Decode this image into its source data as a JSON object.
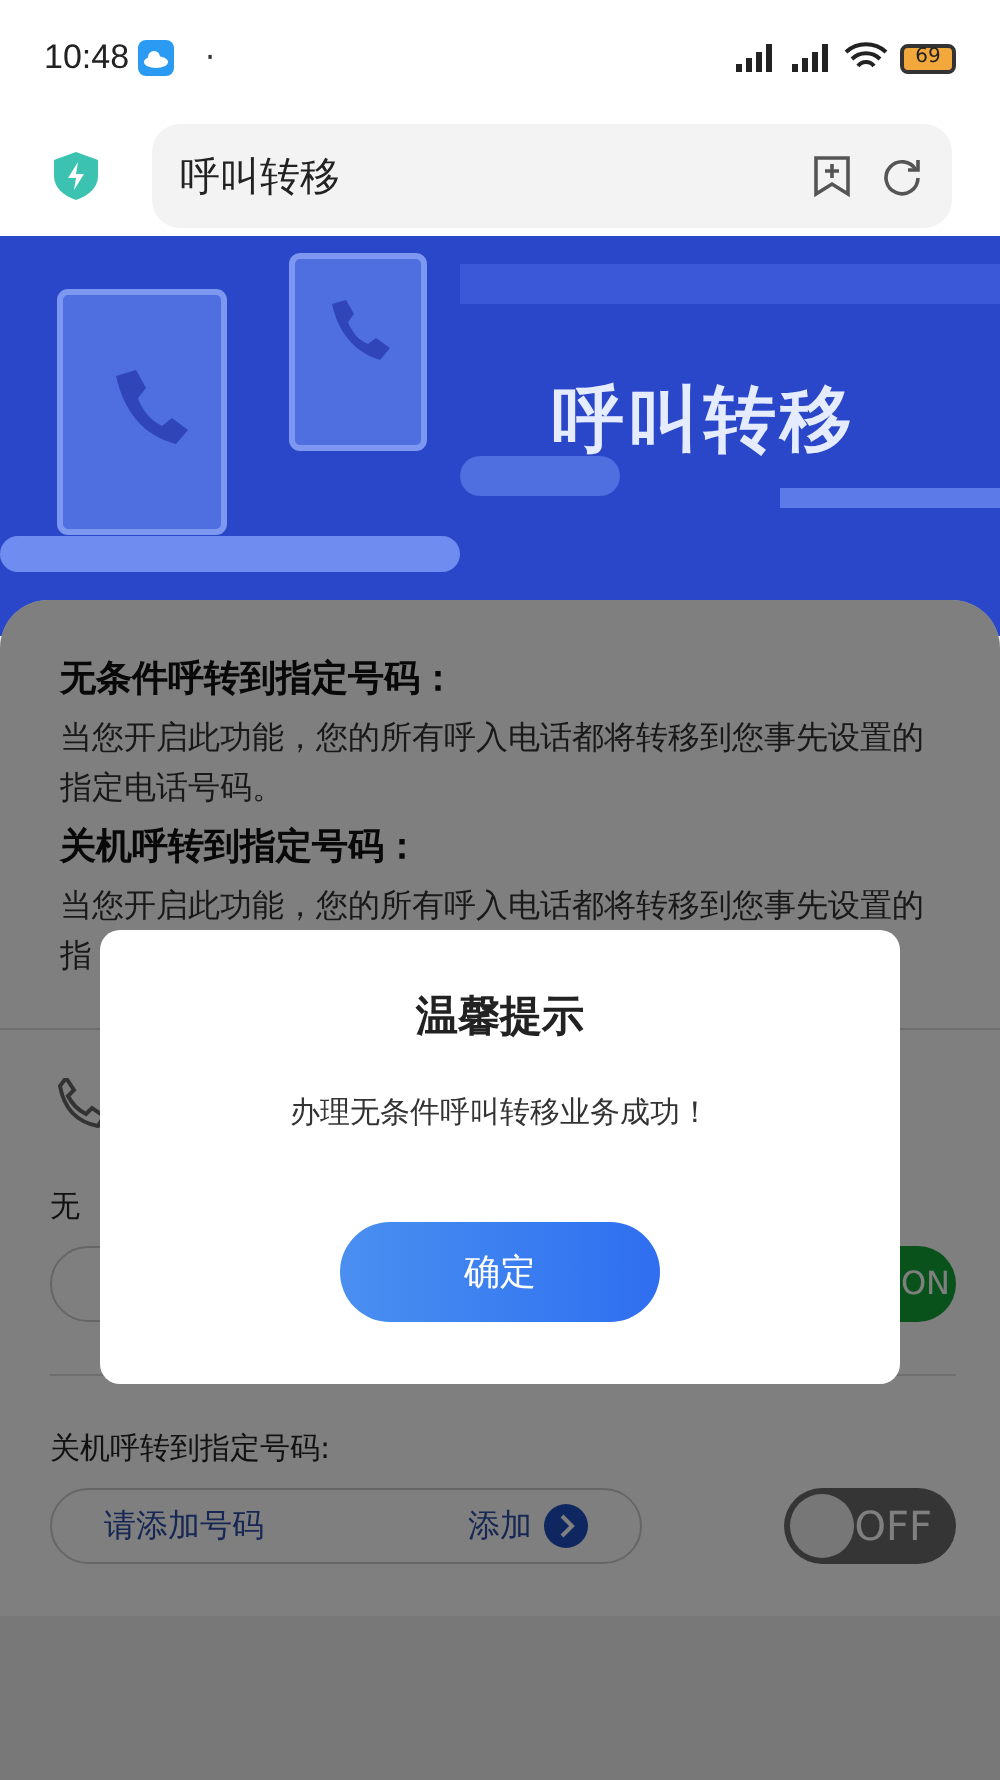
{
  "status_bar": {
    "time": "10:48",
    "dot": "·",
    "battery": "69"
  },
  "address_bar": {
    "title": "呼叫转移"
  },
  "banner": {
    "title": "呼叫转移"
  },
  "info": [
    {
      "heading": "无条件呼转到指定号码：",
      "body": "当您开启此功能，您的所有呼入电话都将转移到您事先设置的指定电话号码。"
    },
    {
      "heading": "关机呼转到指定号码：",
      "body": "当您开启此功能，您的所有呼入电话都将转移到您事先设置的指"
    }
  ],
  "settings": [
    {
      "label": "无",
      "on": true,
      "toggle_label": "ON"
    },
    {
      "label": "关机呼转到指定号码:",
      "placeholder": "请添加号码",
      "add_label": "添加",
      "on": false,
      "toggle_label": "OFF"
    }
  ],
  "dialog": {
    "title": "温馨提示",
    "message": "办理无条件呼叫转移业务成功！",
    "button": "确定"
  }
}
